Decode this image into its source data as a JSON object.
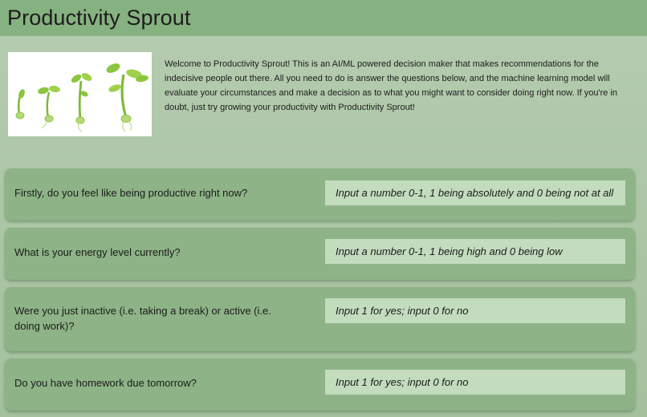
{
  "header": {
    "title": "Productivity Sprout"
  },
  "intro": {
    "image_name": "sprout-growth-image",
    "text": "Welcome to Productivity Sprout! This is an AI/ML powered decision maker that makes recommendations for the indecisive people out there. All you need to do is answer the questions below, and the machine learning model will evaluate your circumstances and make a decision as to what you might want to consider doing right now. If you're in doubt, just try growing your productivity with Productivity Sprout!"
  },
  "questions": [
    {
      "label": "Firstly, do you feel like being productive right now?",
      "placeholder": "Input a number 0-1, 1 being absolutely and 0 being not at all",
      "value": ""
    },
    {
      "label": "What is your energy level currently?",
      "placeholder": "Input a number 0-1, 1 being high and 0 being low",
      "value": ""
    },
    {
      "label": "Were you just inactive (i.e. taking a break) or active (i.e. doing work)?",
      "placeholder": "Input 1 for yes; input 0 for no",
      "value": ""
    },
    {
      "label": "Do you have homework due tomorrow?",
      "placeholder": "Input 1 for yes; input 0 for no",
      "value": ""
    }
  ],
  "colors": {
    "header_bg": "#86b180",
    "page_bg": "#b6ccb0",
    "card_bg": "#8db386",
    "input_bg": "#c3dcbe",
    "sprout_green": "#8cc63f"
  }
}
